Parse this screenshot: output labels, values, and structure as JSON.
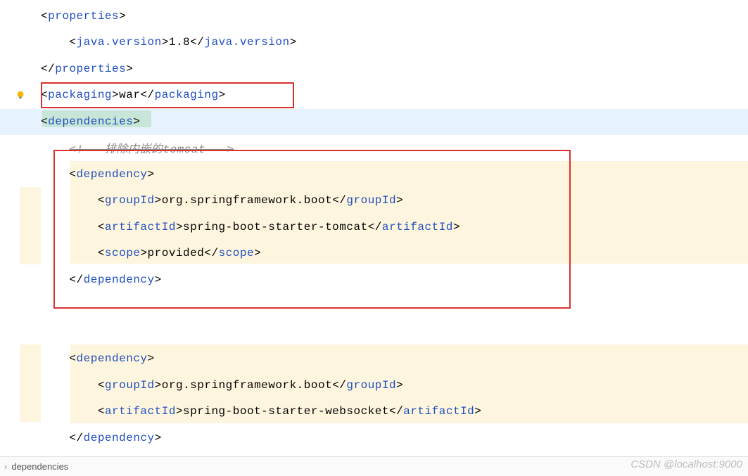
{
  "lines": {
    "l1_open": "properties",
    "l2_open": "java.version",
    "l2_text": "1.8",
    "l2_close": "java.version",
    "l3_close": "properties",
    "l4_open": "packaging",
    "l4_text": "war",
    "l4_close": "packaging",
    "l5_open": "dependencies",
    "l6_comment": "<!-- 排除内嵌的tomcat -->",
    "l7_open": "dependency",
    "l8_open": "groupId",
    "l8_text": "org.springframework.boot",
    "l8_close": "groupId",
    "l9_open": "artifactId",
    "l9_text": "spring-boot-starter-tomcat",
    "l9_close": "artifactId",
    "l10_open": "scope",
    "l10_text": "provided",
    "l10_close": "scope",
    "l11_close": "dependency",
    "l13_open": "dependency",
    "l14_open": "groupId",
    "l14_text": "org.springframework.boot",
    "l14_close": "groupId",
    "l15_open": "artifactId",
    "l15_text": "spring-boot-starter-websocket",
    "l15_close": "artifactId",
    "l16_close": "dependency"
  },
  "breadcrumb": "dependencies",
  "watermark": "CSDN @localhost:9000"
}
